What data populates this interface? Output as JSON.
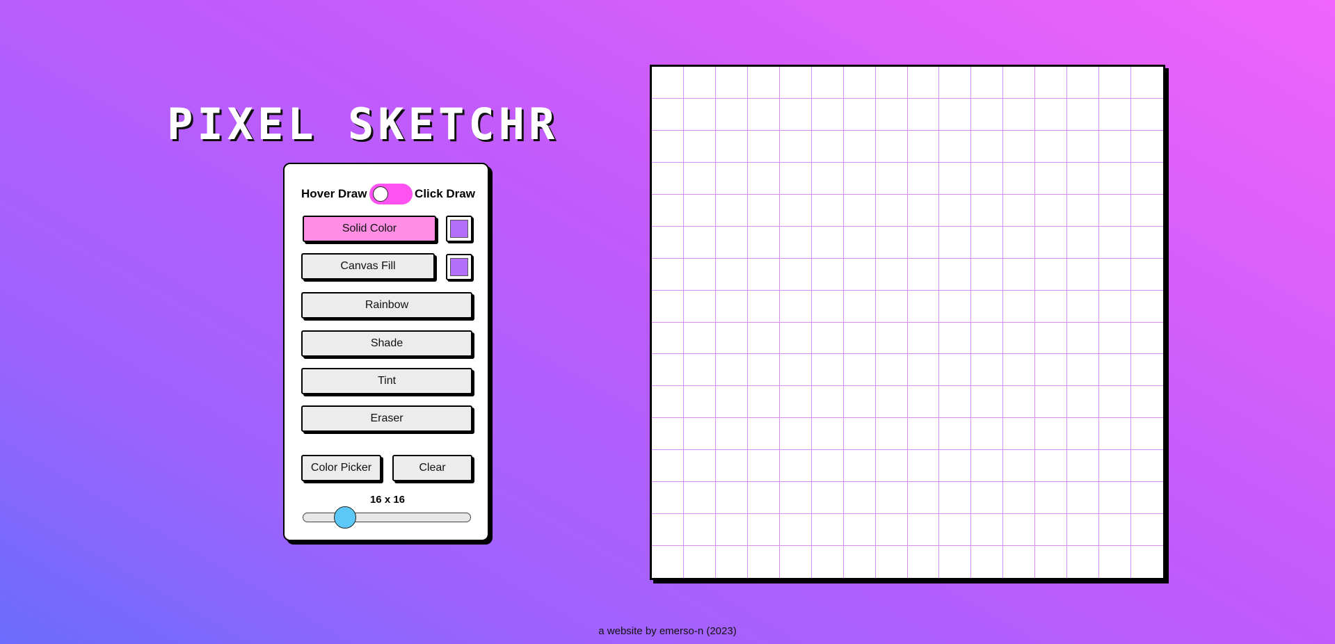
{
  "title": "PIXEL SKETCHR",
  "toggle": {
    "left_label": "Hover Draw",
    "right_label": "Click Draw",
    "state": "hover"
  },
  "buttons": {
    "solid_color": "Solid Color",
    "canvas_fill": "Canvas Fill",
    "rainbow": "Rainbow",
    "shade": "Shade",
    "tint": "Tint",
    "eraser": "Eraser",
    "color_picker": "Color Picker",
    "clear": "Clear"
  },
  "active_mode": "Solid Color",
  "colors": {
    "pen": "#b36efb",
    "fill": "#b36efb",
    "active_button": "#ff8ee4",
    "toggle": "#ff52f0",
    "slider_thumb": "#5bc8f8",
    "grid_line": "#d98cf5"
  },
  "grid": {
    "label": "16 x 16",
    "size": 16
  },
  "footer": "a website by emerso-n (2023)"
}
